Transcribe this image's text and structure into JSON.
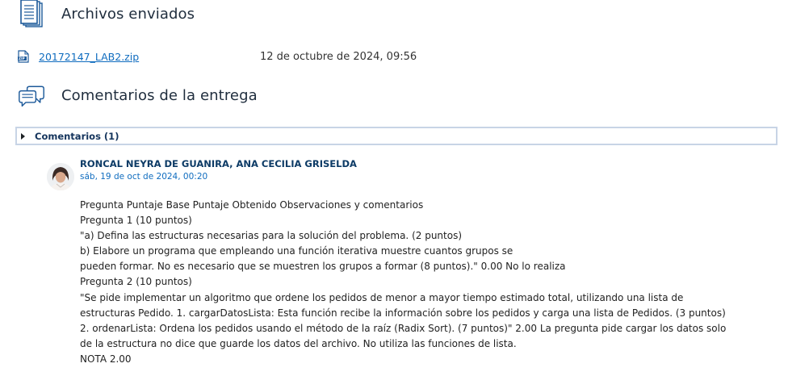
{
  "submitted_files": {
    "heading": "Archivos enviados",
    "icon": "document-stack-icon",
    "files": [
      {
        "name": "20172147_LAB2.zip",
        "date": "12 de octubre de 2024, 09:56",
        "icon": "zip-file-icon"
      }
    ]
  },
  "feedback": {
    "heading": "Comentarios de la entrega",
    "icon": "chat-bubbles-icon",
    "comments_toggle_label": "Comentarios (1)",
    "comment": {
      "author": "RONCAL NEYRA DE GUANIRA, ANA CECILIA GRISELDA",
      "timestamp": "sáb, 19 de oct de 2024, 00:20",
      "lines": [
        "Pregunta Puntaje Base Puntaje Obtenido Observaciones y comentarios",
        "Pregunta 1 (10 puntos)",
        "\"a) Defina las estructuras necesarias para la solución del problema. (2 puntos)",
        "b) Elabore un programa que empleando una función iterativa muestre cuantos grupos se",
        "pueden formar. No es necesario que se muestren los grupos a formar (8 puntos).\" 0.00 No lo realiza",
        "Pregunta 2 (10 puntos)",
        "\"Se pide implementar un algoritmo que ordene los pedidos de menor a mayor tiempo estimado total, utilizando una lista de",
        "estructuras Pedido. 1. cargarDatosLista: Esta función recibe la información sobre los pedidos y carga una lista de Pedidos. (3 puntos)",
        "2. ordenarLista: Ordena los pedidos usando el método de la raíz (Radix Sort). (7 puntos)\" 2.00 La pregunta pide cargar los datos solo",
        "de la estructura no dice que guarde los datos del archivo. No utiliza las funciones de lista.",
        "NOTA 2.00"
      ]
    }
  },
  "colors": {
    "link": "#0f6cbf",
    "heading_text": "#1f2d3d",
    "author_text": "#0d3b66",
    "box_border": "#c8d4e6",
    "icon_blue": "#1d5a9a"
  }
}
